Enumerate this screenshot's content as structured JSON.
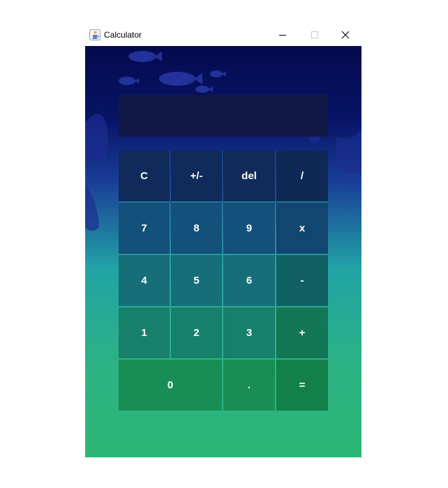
{
  "window": {
    "title": "Calculator",
    "icon": "java-cup-icon",
    "controls": [
      "minimize-icon",
      "maximize-icon",
      "close-icon"
    ]
  },
  "display": {
    "value": ""
  },
  "keys": {
    "clear": "C",
    "negate": "+/-",
    "delete": "del",
    "divide": "/",
    "seven": "7",
    "eight": "8",
    "nine": "9",
    "multiply": "x",
    "four": "4",
    "five": "5",
    "six": "6",
    "subtract": "-",
    "one": "1",
    "two": "2",
    "three": "3",
    "add": "+",
    "zero": "0",
    "decimal": ".",
    "equals": "="
  },
  "colors": {
    "display_bg": "#121845",
    "row1": "#0f2a5b",
    "row2": "#13507a",
    "row3": "#156e78",
    "row4": "#17806a",
    "row5": "#188e55",
    "operator_row3": "#0f5f63",
    "operator_row4": "#137655",
    "operator_row5": "#138049",
    "key_border": "#2a9f9a"
  }
}
